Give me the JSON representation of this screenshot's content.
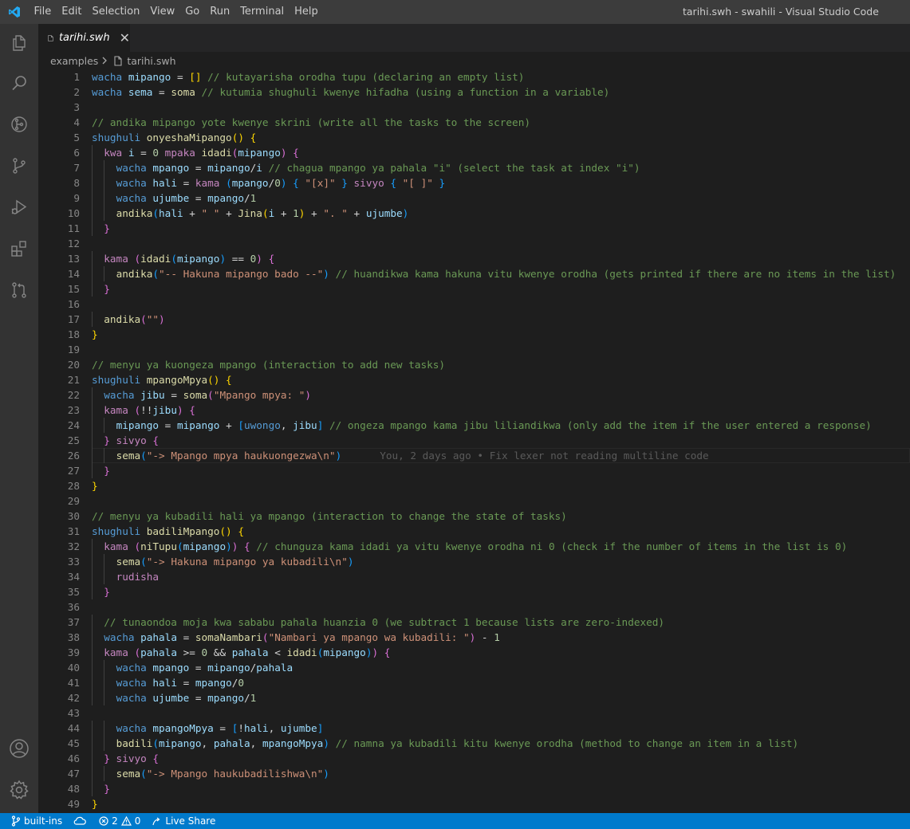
{
  "titlebar": {
    "menu": [
      "File",
      "Edit",
      "Selection",
      "View",
      "Go",
      "Run",
      "Terminal",
      "Help"
    ],
    "window_title": "tarihi.swh - swahili - Visual Studio Code"
  },
  "activitybar": {
    "icons": [
      "files-icon",
      "search-icon",
      "source-control-history-icon",
      "source-control-icon",
      "run-debug-icon",
      "extensions-icon",
      "pull-request-icon",
      "account-icon",
      "settings-gear-icon"
    ]
  },
  "tabs": [
    {
      "label": "tarihi.swh",
      "active": true,
      "italic": true
    }
  ],
  "breadcrumb": {
    "folder": "examples",
    "file": "tarihi.swh"
  },
  "editor": {
    "line_numbers": [
      "1",
      "2",
      "3",
      "4",
      "5",
      "6",
      "7",
      "8",
      "9",
      "10",
      "11",
      "12",
      "13",
      "14",
      "15",
      "16",
      "17",
      "18",
      "19",
      "20",
      "21",
      "22",
      "23",
      "24",
      "25",
      "26",
      "27",
      "28",
      "29",
      "30",
      "31",
      "32",
      "33",
      "34",
      "35",
      "36",
      "37",
      "38",
      "39",
      "40",
      "41",
      "42",
      "43",
      "44",
      "45",
      "46",
      "47",
      "48",
      "49"
    ],
    "current_line": 26,
    "blame": "You, 2 days ago • Fix lexer not reading multiline code",
    "lines": [
      [
        [
          "ty",
          "wacha "
        ],
        [
          "va",
          "mipango"
        ],
        [
          "pl",
          " = "
        ],
        [
          "b1",
          "[]"
        ],
        [
          "co",
          " // kutayarisha orodha tupu (declaring an empty list)"
        ]
      ],
      [
        [
          "ty",
          "wacha "
        ],
        [
          "va",
          "sema"
        ],
        [
          "pl",
          " = "
        ],
        [
          "fn",
          "soma"
        ],
        [
          "co",
          " // kutumia shughuli kwenye hifadha (using a function in a variable)"
        ]
      ],
      [],
      [
        [
          "co",
          "// andika mipango yote kwenye skrini (write all the tasks to the screen)"
        ]
      ],
      [
        [
          "ty",
          "shughuli "
        ],
        [
          "fn",
          "onyeshaMipango"
        ],
        [
          "b1",
          "() {"
        ]
      ],
      [
        [
          "pl",
          "  "
        ],
        [
          "kw",
          "kwa "
        ],
        [
          "va",
          "i"
        ],
        [
          "pl",
          " = "
        ],
        [
          "nu",
          "0"
        ],
        [
          "kw",
          " mpaka "
        ],
        [
          "fn",
          "idadi"
        ],
        [
          "b2",
          "("
        ],
        [
          "va",
          "mipango"
        ],
        [
          "b2",
          ")"
        ],
        [
          "b2",
          " {"
        ]
      ],
      [
        [
          "pl",
          "    "
        ],
        [
          "ty",
          "wacha "
        ],
        [
          "va",
          "mpango"
        ],
        [
          "pl",
          " = "
        ],
        [
          "va",
          "mipango"
        ],
        [
          "pl",
          "/"
        ],
        [
          "va",
          "i"
        ],
        [
          "co",
          " // chagua mpango ya pahala \"i\" (select the task at index \"i\")"
        ]
      ],
      [
        [
          "pl",
          "    "
        ],
        [
          "ty",
          "wacha "
        ],
        [
          "va",
          "hali"
        ],
        [
          "pl",
          " = "
        ],
        [
          "kw",
          "kama "
        ],
        [
          "b3",
          "("
        ],
        [
          "va",
          "mpango"
        ],
        [
          "pl",
          "/"
        ],
        [
          "nu",
          "0"
        ],
        [
          "b3",
          ")"
        ],
        [
          "b3",
          " { "
        ],
        [
          "st",
          "\"[x]\""
        ],
        [
          "b3",
          " }"
        ],
        [
          "kw",
          " sivyo "
        ],
        [
          "b3",
          "{ "
        ],
        [
          "st",
          "\"[ ]\""
        ],
        [
          "b3",
          " }"
        ]
      ],
      [
        [
          "pl",
          "    "
        ],
        [
          "ty",
          "wacha "
        ],
        [
          "va",
          "ujumbe"
        ],
        [
          "pl",
          " = "
        ],
        [
          "va",
          "mpango"
        ],
        [
          "pl",
          "/"
        ],
        [
          "nu",
          "1"
        ]
      ],
      [
        [
          "pl",
          "    "
        ],
        [
          "fn",
          "andika"
        ],
        [
          "b3",
          "("
        ],
        [
          "va",
          "hali"
        ],
        [
          "pl",
          " + "
        ],
        [
          "st",
          "\" \""
        ],
        [
          "pl",
          " + "
        ],
        [
          "fn",
          "Jina"
        ],
        [
          "b1",
          "("
        ],
        [
          "va",
          "i"
        ],
        [
          "pl",
          " + "
        ],
        [
          "nu",
          "1"
        ],
        [
          "b1",
          ")"
        ],
        [
          "pl",
          " + "
        ],
        [
          "st",
          "\". \""
        ],
        [
          "pl",
          " + "
        ],
        [
          "va",
          "ujumbe"
        ],
        [
          "b3",
          ")"
        ]
      ],
      [
        [
          "pl",
          "  "
        ],
        [
          "b2",
          "}"
        ]
      ],
      [],
      [
        [
          "pl",
          "  "
        ],
        [
          "kw",
          "kama "
        ],
        [
          "b2",
          "("
        ],
        [
          "fn",
          "idadi"
        ],
        [
          "b3",
          "("
        ],
        [
          "va",
          "mipango"
        ],
        [
          "b3",
          ")"
        ],
        [
          "pl",
          " == "
        ],
        [
          "nu",
          "0"
        ],
        [
          "b2",
          ")"
        ],
        [
          "b2",
          " {"
        ]
      ],
      [
        [
          "pl",
          "    "
        ],
        [
          "fn",
          "andika"
        ],
        [
          "b3",
          "("
        ],
        [
          "st",
          "\"-- Hakuna mipango bado --\""
        ],
        [
          "b3",
          ")"
        ],
        [
          "co",
          " // huandikwa kama hakuna vitu kwenye orodha (gets printed if there are no items in the list)"
        ]
      ],
      [
        [
          "pl",
          "  "
        ],
        [
          "b2",
          "}"
        ]
      ],
      [],
      [
        [
          "pl",
          "  "
        ],
        [
          "fn",
          "andika"
        ],
        [
          "b2",
          "("
        ],
        [
          "st",
          "\"\""
        ],
        [
          "b2",
          ")"
        ]
      ],
      [
        [
          "b1",
          "}"
        ]
      ],
      [],
      [
        [
          "co",
          "// menyu ya kuongeza mpango (interaction to add new tasks)"
        ]
      ],
      [
        [
          "ty",
          "shughuli "
        ],
        [
          "fn",
          "mpangoMpya"
        ],
        [
          "b1",
          "() {"
        ]
      ],
      [
        [
          "pl",
          "  "
        ],
        [
          "ty",
          "wacha "
        ],
        [
          "va",
          "jibu"
        ],
        [
          "pl",
          " = "
        ],
        [
          "fn",
          "soma"
        ],
        [
          "b2",
          "("
        ],
        [
          "st",
          "\"Mpango mpya: \""
        ],
        [
          "b2",
          ")"
        ]
      ],
      [
        [
          "pl",
          "  "
        ],
        [
          "kw",
          "kama "
        ],
        [
          "b2",
          "("
        ],
        [
          "pl",
          "!!"
        ],
        [
          "va",
          "jibu"
        ],
        [
          "b2",
          ")"
        ],
        [
          "b2",
          " {"
        ]
      ],
      [
        [
          "pl",
          "    "
        ],
        [
          "va",
          "mipango"
        ],
        [
          "pl",
          " = "
        ],
        [
          "va",
          "mipango"
        ],
        [
          "pl",
          " + "
        ],
        [
          "b3",
          "["
        ],
        [
          "ty",
          "uwongo"
        ],
        [
          "pl",
          ", "
        ],
        [
          "va",
          "jibu"
        ],
        [
          "b3",
          "]"
        ],
        [
          "co",
          " // ongeza mpango kama jibu liliandikwa (only add the item if the user entered a response)"
        ]
      ],
      [
        [
          "pl",
          "  "
        ],
        [
          "b2",
          "}"
        ],
        [
          "kw",
          " sivyo "
        ],
        [
          "b2",
          "{"
        ]
      ],
      [
        [
          "pl",
          "    "
        ],
        [
          "fn",
          "sema"
        ],
        [
          "b3",
          "("
        ],
        [
          "st",
          "\"-> Mpango mpya haukuongezwa\\n\""
        ],
        [
          "b3",
          ")"
        ]
      ],
      [
        [
          "pl",
          "  "
        ],
        [
          "b2",
          "}"
        ]
      ],
      [
        [
          "b1",
          "}"
        ]
      ],
      [],
      [
        [
          "co",
          "// menyu ya kubadili hali ya mpango (interaction to change the state of tasks)"
        ]
      ],
      [
        [
          "ty",
          "shughuli "
        ],
        [
          "fn",
          "badiliMpango"
        ],
        [
          "b1",
          "() {"
        ]
      ],
      [
        [
          "pl",
          "  "
        ],
        [
          "kw",
          "kama "
        ],
        [
          "b2",
          "("
        ],
        [
          "fn",
          "niTupu"
        ],
        [
          "b3",
          "("
        ],
        [
          "va",
          "mipango"
        ],
        [
          "b3",
          ")"
        ],
        [
          "b2",
          ")"
        ],
        [
          "b2",
          " {"
        ],
        [
          "co",
          " // chunguza kama idadi ya vitu kwenye orodha ni 0 (check if the number of items in the list is 0)"
        ]
      ],
      [
        [
          "pl",
          "    "
        ],
        [
          "fn",
          "sema"
        ],
        [
          "b3",
          "("
        ],
        [
          "st",
          "\"-> Hakuna mipango ya kubadili\\n\""
        ],
        [
          "b3",
          ")"
        ]
      ],
      [
        [
          "pl",
          "    "
        ],
        [
          "kw",
          "rudisha"
        ]
      ],
      [
        [
          "pl",
          "  "
        ],
        [
          "b2",
          "}"
        ]
      ],
      [],
      [
        [
          "pl",
          "  "
        ],
        [
          "co",
          "// tunaondoa moja kwa sababu pahala huanzia 0 (we subtract 1 because lists are zero-indexed)"
        ]
      ],
      [
        [
          "pl",
          "  "
        ],
        [
          "ty",
          "wacha "
        ],
        [
          "va",
          "pahala"
        ],
        [
          "pl",
          " = "
        ],
        [
          "fn",
          "somaNambari"
        ],
        [
          "b2",
          "("
        ],
        [
          "st",
          "\"Nambari ya mpango wa kubadili: \""
        ],
        [
          "b2",
          ")"
        ],
        [
          "pl",
          " - "
        ],
        [
          "nu",
          "1"
        ]
      ],
      [
        [
          "pl",
          "  "
        ],
        [
          "kw",
          "kama "
        ],
        [
          "b2",
          "("
        ],
        [
          "va",
          "pahala"
        ],
        [
          "pl",
          " >= "
        ],
        [
          "nu",
          "0"
        ],
        [
          "pl",
          " && "
        ],
        [
          "va",
          "pahala"
        ],
        [
          "pl",
          " < "
        ],
        [
          "fn",
          "idadi"
        ],
        [
          "b3",
          "("
        ],
        [
          "va",
          "mipango"
        ],
        [
          "b3",
          ")"
        ],
        [
          "b2",
          ")"
        ],
        [
          "b2",
          " {"
        ]
      ],
      [
        [
          "pl",
          "    "
        ],
        [
          "ty",
          "wacha "
        ],
        [
          "va",
          "mpango"
        ],
        [
          "pl",
          " = "
        ],
        [
          "va",
          "mipango"
        ],
        [
          "pl",
          "/"
        ],
        [
          "va",
          "pahala"
        ]
      ],
      [
        [
          "pl",
          "    "
        ],
        [
          "ty",
          "wacha "
        ],
        [
          "va",
          "hali"
        ],
        [
          "pl",
          " = "
        ],
        [
          "va",
          "mpango"
        ],
        [
          "pl",
          "/"
        ],
        [
          "nu",
          "0"
        ]
      ],
      [
        [
          "pl",
          "    "
        ],
        [
          "ty",
          "wacha "
        ],
        [
          "va",
          "ujumbe"
        ],
        [
          "pl",
          " = "
        ],
        [
          "va",
          "mpango"
        ],
        [
          "pl",
          "/"
        ],
        [
          "nu",
          "1"
        ]
      ],
      [],
      [
        [
          "pl",
          "    "
        ],
        [
          "ty",
          "wacha "
        ],
        [
          "va",
          "mpangoMpya"
        ],
        [
          "pl",
          " = "
        ],
        [
          "b3",
          "["
        ],
        [
          "pl",
          "!"
        ],
        [
          "va",
          "hali"
        ],
        [
          "pl",
          ", "
        ],
        [
          "va",
          "ujumbe"
        ],
        [
          "b3",
          "]"
        ]
      ],
      [
        [
          "pl",
          "    "
        ],
        [
          "fn",
          "badili"
        ],
        [
          "b3",
          "("
        ],
        [
          "va",
          "mipango"
        ],
        [
          "pl",
          ", "
        ],
        [
          "va",
          "pahala"
        ],
        [
          "pl",
          ", "
        ],
        [
          "va",
          "mpangoMpya"
        ],
        [
          "b3",
          ")"
        ],
        [
          "co",
          " // namna ya kubadili kitu kwenye orodha (method to change an item in a list)"
        ]
      ],
      [
        [
          "pl",
          "  "
        ],
        [
          "b2",
          "}"
        ],
        [
          "kw",
          " sivyo "
        ],
        [
          "b2",
          "{"
        ]
      ],
      [
        [
          "pl",
          "    "
        ],
        [
          "fn",
          "sema"
        ],
        [
          "b3",
          "("
        ],
        [
          "st",
          "\"-> Mpango haukubadilishwa\\n\""
        ],
        [
          "b3",
          ")"
        ]
      ],
      [
        [
          "pl",
          "  "
        ],
        [
          "b2",
          "}"
        ]
      ],
      [
        [
          "b1",
          "}"
        ]
      ]
    ]
  },
  "statusbar": {
    "branch": "built-ins",
    "errors": "2",
    "warnings": "0",
    "live_share": "Live Share"
  },
  "colors": {
    "accent": "#007acc",
    "editor_bg": "#1e1e1e",
    "activitybar_bg": "#333333",
    "titlebar_bg": "#3c3c3c"
  }
}
